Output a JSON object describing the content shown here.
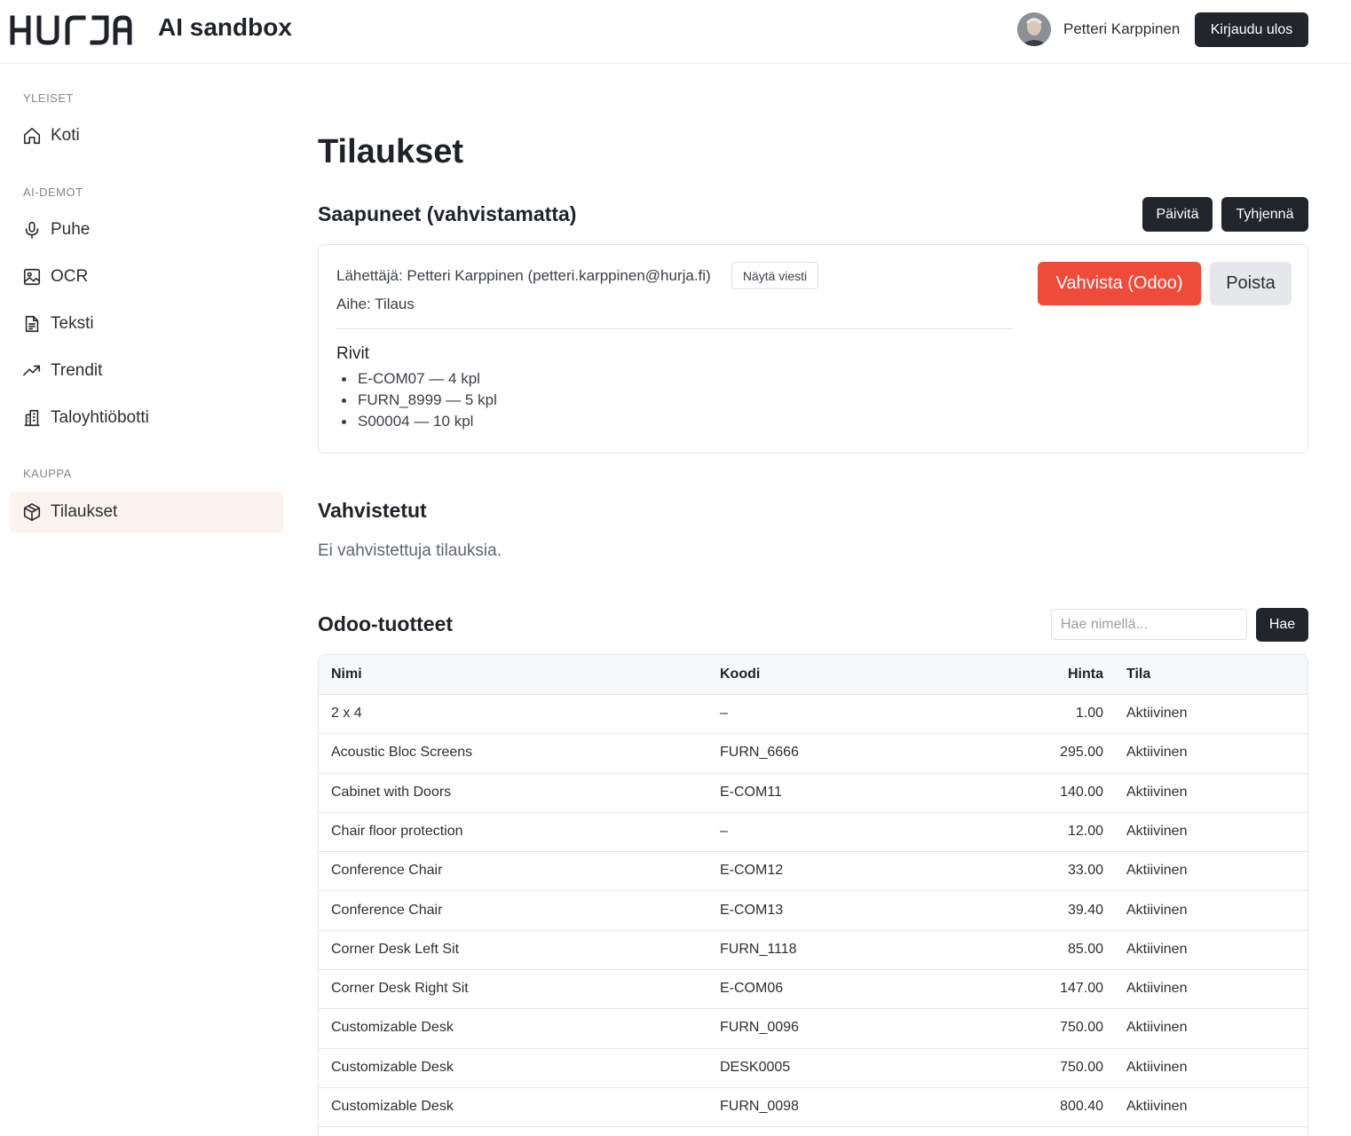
{
  "header": {
    "logo_text": "HURJA",
    "app_title": "AI sandbox",
    "user_name": "Petteri Karppinen",
    "logout_label": "Kirjaudu ulos"
  },
  "sidebar": {
    "sections": [
      {
        "label": "YLEISET",
        "items": [
          {
            "label": "Koti",
            "icon": "home-icon"
          }
        ]
      },
      {
        "label": "AI-DEMOT",
        "items": [
          {
            "label": "Puhe",
            "icon": "microphone-icon"
          },
          {
            "label": "OCR",
            "icon": "image-icon"
          },
          {
            "label": "Teksti",
            "icon": "document-icon"
          },
          {
            "label": "Trendit",
            "icon": "trend-icon"
          },
          {
            "label": "Taloyhtiöbotti",
            "icon": "building-icon"
          }
        ]
      },
      {
        "label": "KAUPPA",
        "items": [
          {
            "label": "Tilaukset",
            "icon": "package-icon",
            "active": true
          }
        ]
      }
    ]
  },
  "main": {
    "page_title": "Tilaukset",
    "pending": {
      "title": "Saapuneet (vahvistamatta)",
      "refresh_label": "Päivitä",
      "clear_label": "Tyhjennä",
      "order": {
        "sender": "Lähettäjä: Petteri Karppinen (petteri.karppinen@hurja.fi)",
        "show_message_label": "Näytä viesti",
        "subject": "Aihe: Tilaus",
        "rows_title": "Rivit",
        "rows": [
          "E-COM07 — 4 kpl",
          "FURN_8999 — 5 kpl",
          "S00004 — 10 kpl"
        ],
        "confirm_label": "Vahvista (Odoo)",
        "delete_label": "Poista"
      }
    },
    "confirmed": {
      "title": "Vahvistetut",
      "empty_text": "Ei vahvistettuja tilauksia."
    },
    "products": {
      "title": "Odoo-tuotteet",
      "search_placeholder": "Hae nimellä...",
      "search_button": "Hae",
      "columns": [
        "Nimi",
        "Koodi",
        "Hinta",
        "Tila"
      ],
      "rows": [
        {
          "name": "2 x 4",
          "code": "–",
          "price": "1.00",
          "status": "Aktiivinen"
        },
        {
          "name": "Acoustic Bloc Screens",
          "code": "FURN_6666",
          "price": "295.00",
          "status": "Aktiivinen"
        },
        {
          "name": "Cabinet with Doors",
          "code": "E-COM11",
          "price": "140.00",
          "status": "Aktiivinen"
        },
        {
          "name": "Chair floor protection",
          "code": "–",
          "price": "12.00",
          "status": "Aktiivinen"
        },
        {
          "name": "Conference Chair",
          "code": "E-COM12",
          "price": "33.00",
          "status": "Aktiivinen"
        },
        {
          "name": "Conference Chair",
          "code": "E-COM13",
          "price": "39.40",
          "status": "Aktiivinen"
        },
        {
          "name": "Corner Desk Left Sit",
          "code": "FURN_1118",
          "price": "85.00",
          "status": "Aktiivinen"
        },
        {
          "name": "Corner Desk Right Sit",
          "code": "E-COM06",
          "price": "147.00",
          "status": "Aktiivinen"
        },
        {
          "name": "Customizable Desk",
          "code": "FURN_0096",
          "price": "750.00",
          "status": "Aktiivinen"
        },
        {
          "name": "Customizable Desk",
          "code": "DESK0005",
          "price": "750.00",
          "status": "Aktiivinen"
        },
        {
          "name": "Customizable Desk",
          "code": "FURN_0098",
          "price": "800.40",
          "status": "Aktiivinen"
        }
      ]
    }
  }
}
